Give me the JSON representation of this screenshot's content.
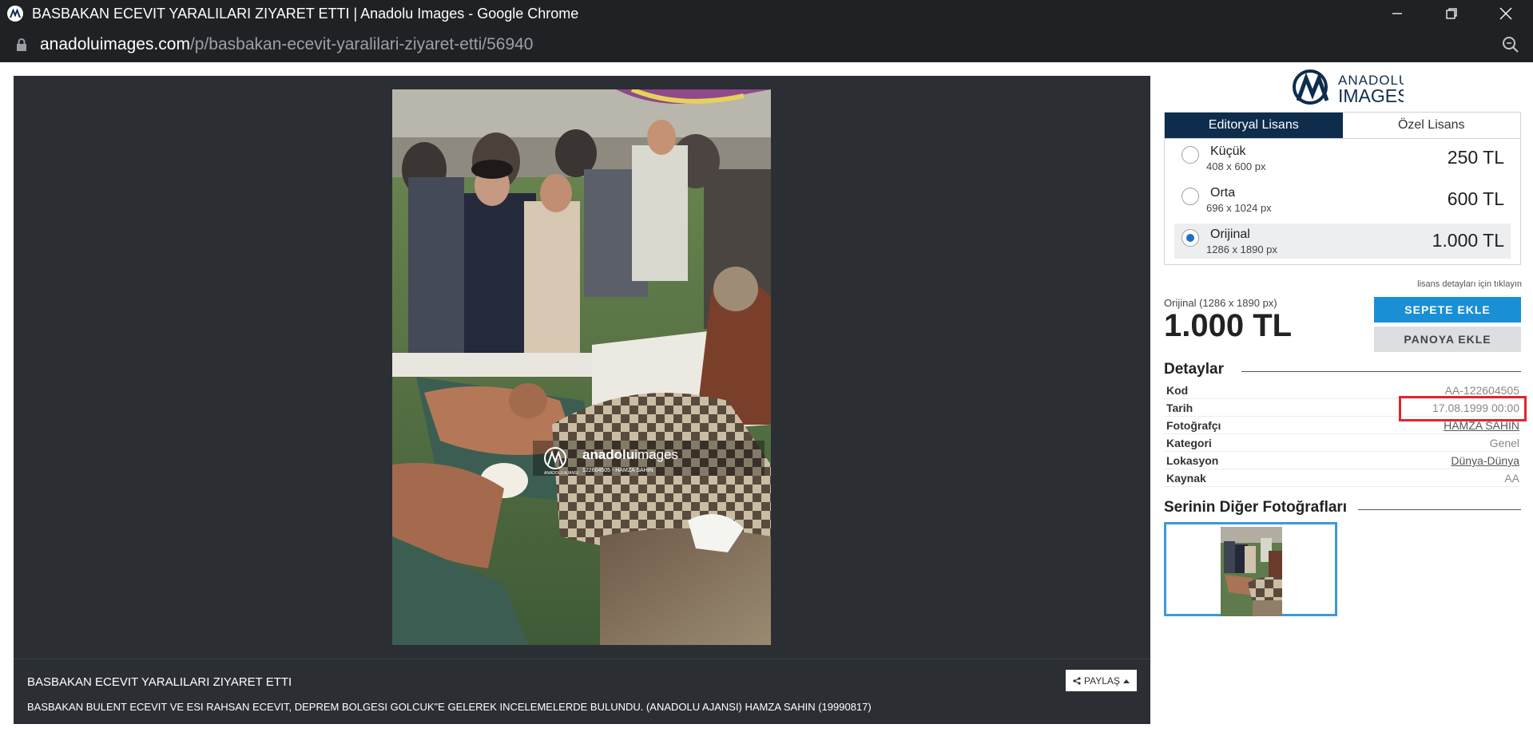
{
  "window": {
    "title": "BASBAKAN ECEVIT YARALILARI ZIYARET ETTI | Anadolu Images - Google Chrome",
    "app_icon": "anadolu-agency-icon",
    "controls": [
      "minimize-icon",
      "restore-icon",
      "close-icon"
    ]
  },
  "address_bar": {
    "host": "anadoluimages.com",
    "path": "/p/basbakan-ecevit-yaralilari-ziyaret-etti/56940",
    "lock_icon": "lock-icon",
    "zoom_icon": "zoom-icon"
  },
  "photo": {
    "watermark_brand_prefix": "anadolu",
    "watermark_brand_suffix": "images",
    "watermark_line": "122604505 - HAMZA SAHIN",
    "watermark_agency": "ANADOLU AJANSI"
  },
  "caption": {
    "title": "BASBAKAN ECEVIT YARALILARI ZIYARET ETTI",
    "description": "BASBAKAN BULENT ECEVIT VE ESI RAHSAN ECEVIT, DEPREM BOLGESI GOLCUK\"E GELEREK INCELEMELERDE BULUNDU. (ANADOLU AJANSI) HAMZA SAHIN (19990817)",
    "share_label": "PAYLAŞ"
  },
  "brand": {
    "line1": "ANADOLU",
    "line2": "IMAGES",
    "color": "#0e2d4d"
  },
  "license": {
    "tabs": [
      {
        "label": "Editoryal Lisans",
        "active": true
      },
      {
        "label": "Özel Lisans",
        "active": false
      }
    ],
    "sizes": [
      {
        "name": "Küçük",
        "dimensions": "408 x 600 px",
        "price": "250 TL",
        "selected": false
      },
      {
        "name": "Orta",
        "dimensions": "696 x 1024 px",
        "price": "600 TL",
        "selected": false
      },
      {
        "name": "Orijinal",
        "dimensions": "1286 x 1890 px",
        "price": "1.000 TL",
        "selected": true
      }
    ],
    "details_link": "lisans detayları için tıklayın",
    "selected_label": "Orijinal (1286 x 1890 px)",
    "selected_price": "1.000 TL",
    "add_to_cart": "SEPETE EKLE",
    "add_to_board": "PANOYA EKLE"
  },
  "details": {
    "heading": "Detaylar",
    "rows": [
      {
        "label": "Kod",
        "value": "AA-122604505",
        "link": false
      },
      {
        "label": "Tarih",
        "value": "17.08.1999 00:00",
        "link": false
      },
      {
        "label": "Fotoğrafçı",
        "value": "HAMZA SAHIN",
        "link": true
      },
      {
        "label": "Kategori",
        "value": "Genel",
        "link": false
      },
      {
        "label": "Lokasyon",
        "value": "Dünya-Dünya",
        "link": true
      },
      {
        "label": "Kaynak",
        "value": "AA",
        "link": false
      }
    ]
  },
  "series": {
    "heading": "Serinin Diğer Fotoğrafları"
  },
  "colors": {
    "accent_blue": "#1a8fd6",
    "tab_navy": "#0e2d4d",
    "viewer_bg": "#2b2f33",
    "highlight_red": "#e0262b"
  }
}
